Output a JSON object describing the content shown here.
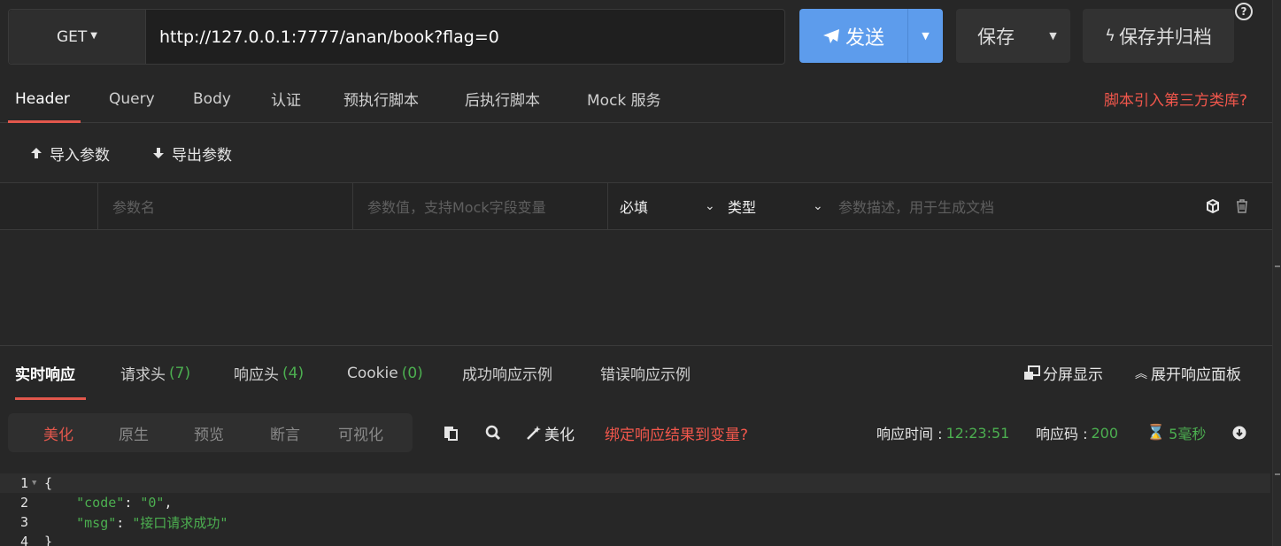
{
  "request": {
    "method": "GET",
    "url": "http://127.0.0.1:7777/anan/book?flag=0",
    "send_label": "发送",
    "save_label": "保存",
    "save_archive_label": "保存并归档",
    "help_icon": "?"
  },
  "tabs": {
    "items": [
      "Header",
      "Query",
      "Body",
      "认证",
      "预执行脚本",
      "后执行脚本",
      "Mock 服务"
    ],
    "active": "Header",
    "script_link": "脚本引入第三方类库?"
  },
  "params": {
    "import_label": "导入参数",
    "export_label": "导出参数",
    "name_placeholder": "参数名",
    "value_placeholder": "参数值，支持Mock字段变量",
    "required_label": "必填",
    "type_label": "类型",
    "desc_placeholder": "参数描述，用于生成文档"
  },
  "response": {
    "tabs": {
      "realtime": "实时响应",
      "req_headers": "请求头",
      "req_headers_count": "(7)",
      "resp_headers": "响应头",
      "resp_headers_count": "(4)",
      "cookie": "Cookie",
      "cookie_count": "(0)",
      "success_example": "成功响应示例",
      "error_example": "错误响应示例"
    },
    "split_view": "分屏显示",
    "expand_panel": "展开响应面板",
    "view_modes": [
      "美化",
      "原生",
      "预览",
      "断言",
      "可视化"
    ],
    "active_mode": "美化",
    "beautify_label": "美化",
    "bind_link": "绑定响应结果到变量?",
    "time_label": "响应时间 :",
    "time_value": "12:23:51",
    "code_label": "响应码 :",
    "code_value": "200",
    "duration_value": "5毫秒",
    "body_lines": [
      {
        "num": "1",
        "text": "{"
      },
      {
        "num": "2",
        "key": "\"code\"",
        "value": "\"0\""
      },
      {
        "num": "3",
        "key": "\"msg\"",
        "value": "\"接口请求成功\""
      },
      {
        "num": "4",
        "text": "}"
      }
    ]
  },
  "colors": {
    "accent": "#5d9cec",
    "danger": "#e2574c",
    "success": "#4caf50",
    "background": "#272727"
  }
}
